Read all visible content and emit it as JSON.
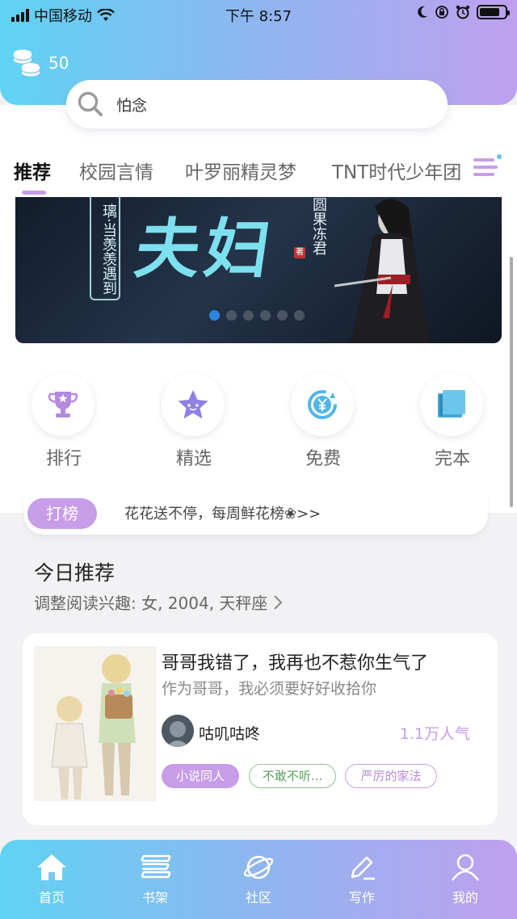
{
  "status_bar": {
    "carrier": "中国移动",
    "time": "下午 8:57",
    "battery_level": 0.8
  },
  "header": {
    "coin_count": "50",
    "search_query": "怕念"
  },
  "tabs": [
    {
      "label": "推荐",
      "active": true
    },
    {
      "label": "校园言情"
    },
    {
      "label": "叶罗丽精灵梦"
    },
    {
      "label": "TNT时代少年团"
    }
  ],
  "banner": {
    "title_art": "夫妇",
    "vertical_text": "璃·当羡羡遇到",
    "author_text": "圆果冻君",
    "seal": "著",
    "active_index": 0,
    "dot_count": 6
  },
  "quick_entries": [
    {
      "label": "排行",
      "icon": "trophy-icon"
    },
    {
      "label": "精选",
      "icon": "star-icon"
    },
    {
      "label": "免费",
      "icon": "yen-refresh-icon"
    },
    {
      "label": "完本",
      "icon": "book-icon"
    }
  ],
  "promo": {
    "tag": "打榜",
    "text": "花花送不停，每周鲜花榜❀>>"
  },
  "today": {
    "title": "今日推荐",
    "subtitle": "调整阅读兴趣: 女, 2004, 天秤座"
  },
  "book_card": {
    "title": "哥哥我错了，我再也不惹你生气了",
    "subtitle": "作为哥哥，我必须要好好收拾你",
    "author": "咕叽咕咚",
    "popularity": "1.1万人气",
    "tags": [
      "小说同人",
      "不敢不听...",
      "严厉的家法"
    ]
  },
  "bottom_nav": [
    {
      "label": "首页",
      "icon": "home-icon",
      "active": true
    },
    {
      "label": "书架",
      "icon": "bookshelf-icon"
    },
    {
      "label": "社区",
      "icon": "planet-icon"
    },
    {
      "label": "写作",
      "icon": "pen-icon"
    },
    {
      "label": "我的",
      "icon": "user-icon"
    }
  ],
  "colors": {
    "accent": "#c79de8",
    "gradient_start": "#5fd3f2",
    "gradient_end": "#bfa0ee"
  }
}
